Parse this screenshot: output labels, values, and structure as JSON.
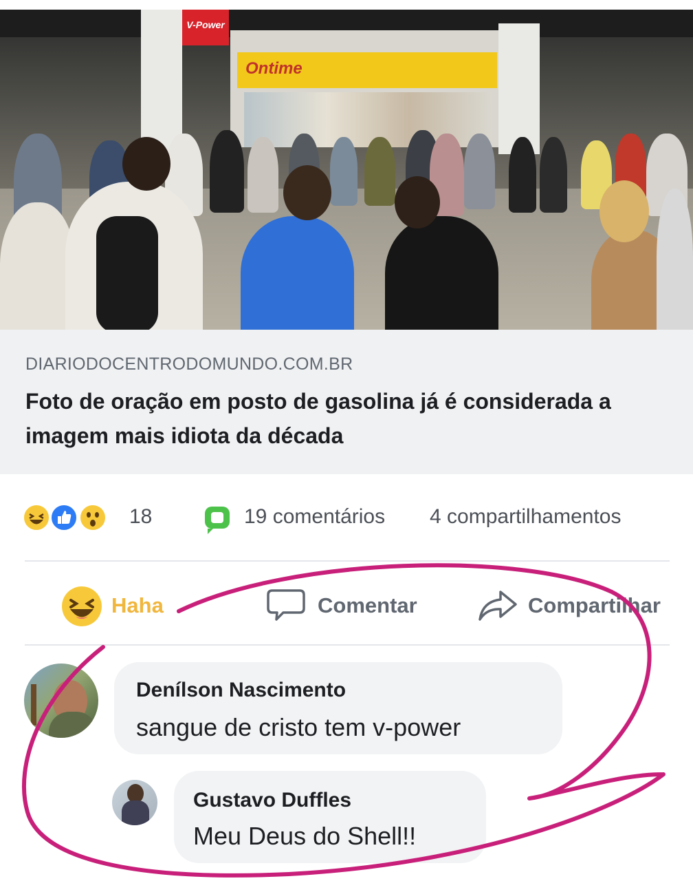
{
  "photo": {
    "signs": {
      "vpower": "V-Power",
      "store": "Ontime"
    }
  },
  "preview": {
    "domain": "DIARIODOCENTRODOMUNDO.COM.BR",
    "title": "Foto de oração em posto de gasolina já é considerada a imagem mais idiota da década"
  },
  "stats": {
    "reaction_icons": [
      "haha-icon",
      "like-icon",
      "wow-icon"
    ],
    "reaction_count": "18",
    "comments": "19 comentários",
    "shares": "4 compartilhamentos"
  },
  "actions": {
    "haha": "Haha",
    "comment": "Comentar",
    "share": "Compartilhar"
  },
  "comments": [
    {
      "author": "Denílson Nascimento",
      "text": "sangue de cristo tem v-power"
    },
    {
      "author": "Gustavo Duffles",
      "text": "Meu Deus do Shell!!"
    }
  ],
  "colors": {
    "haha_active": "#f0b63d",
    "annotation": "#c8207a",
    "comment_icon": "#4cc24a",
    "like": "#2d7cf6"
  }
}
